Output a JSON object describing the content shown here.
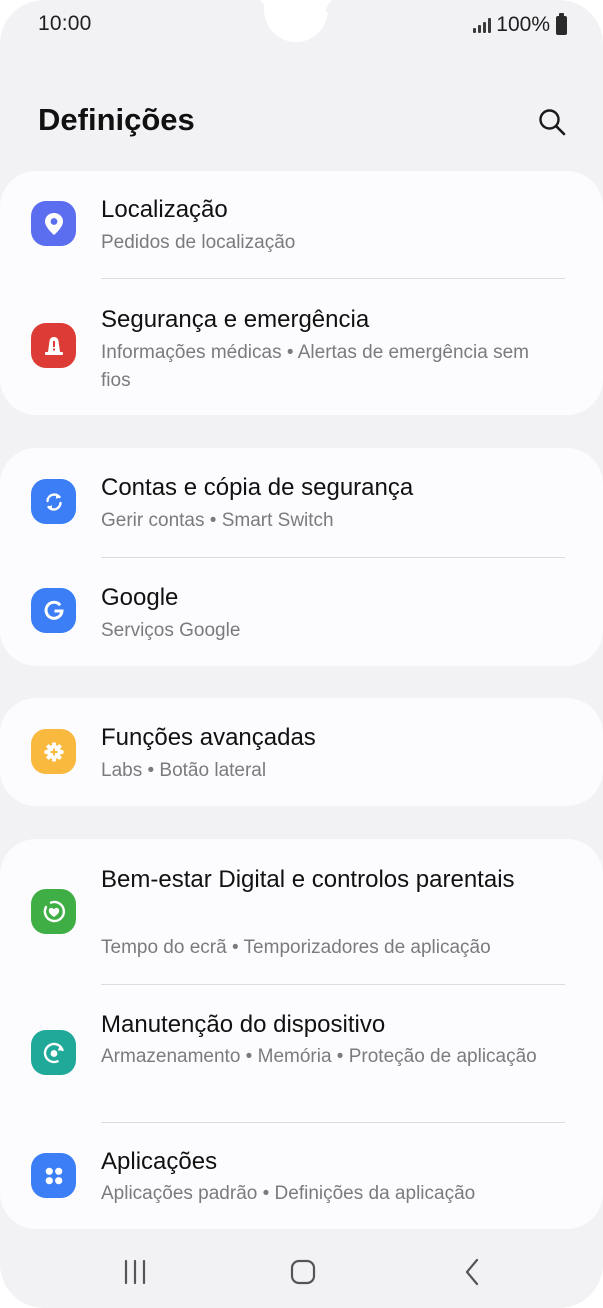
{
  "status_bar": {
    "time": "10:00",
    "battery": "100%"
  },
  "header": {
    "title": "Definições",
    "search_icon": "search-icon"
  },
  "colors": {
    "background": "#f2f2f4",
    "card": "#fcfcfe",
    "location_icon_bg": "#5b6ef0",
    "safety_icon_bg": "#dd3b35",
    "accounts_icon_bg": "#3b7ef5",
    "google_icon_bg": "#3b7ef5",
    "advanced_icon_bg": "#f9b93f",
    "wellbeing_icon_bg": "#3fae45",
    "care_icon_bg": "#20a898",
    "apps_icon_bg": "#3b7ef5"
  },
  "groups": [
    {
      "items": [
        {
          "title": "Localização",
          "subtitle": "Pedidos de localização",
          "icon": "location-pin-icon"
        },
        {
          "title": "Segurança e emergência",
          "subtitle": "Informações médicas  •  Alertas de emergência sem fios",
          "icon": "emergency-alert-icon"
        }
      ]
    },
    {
      "items": [
        {
          "title": "Contas e cópia de segurança",
          "subtitle": "Gerir contas  •  Smart Switch",
          "icon": "sync-icon"
        },
        {
          "title": "Google",
          "subtitle": "Serviços Google",
          "icon": "google-g-icon"
        }
      ]
    },
    {
      "items": [
        {
          "title": "Funções avançadas",
          "subtitle": "Labs  •  Botão lateral",
          "icon": "gear-plus-icon"
        }
      ]
    },
    {
      "items": [
        {
          "title": "Bem-estar Digital e controlos parentais",
          "subtitle": "Tempo do ecrã  •  Temporizadores de aplicação",
          "icon": "heart-circle-icon"
        },
        {
          "title": "Manutenção do dispositivo",
          "subtitle": "Armazenamento  •  Memória  •  Proteção de aplicação",
          "icon": "device-care-icon"
        },
        {
          "title": "Aplicações",
          "subtitle": "Aplicações padrão  •  Definições da aplicação",
          "icon": "apps-grid-icon"
        }
      ]
    }
  ],
  "nav_bar": {
    "recents": "recents-icon",
    "home": "home-icon",
    "back": "back-icon"
  }
}
